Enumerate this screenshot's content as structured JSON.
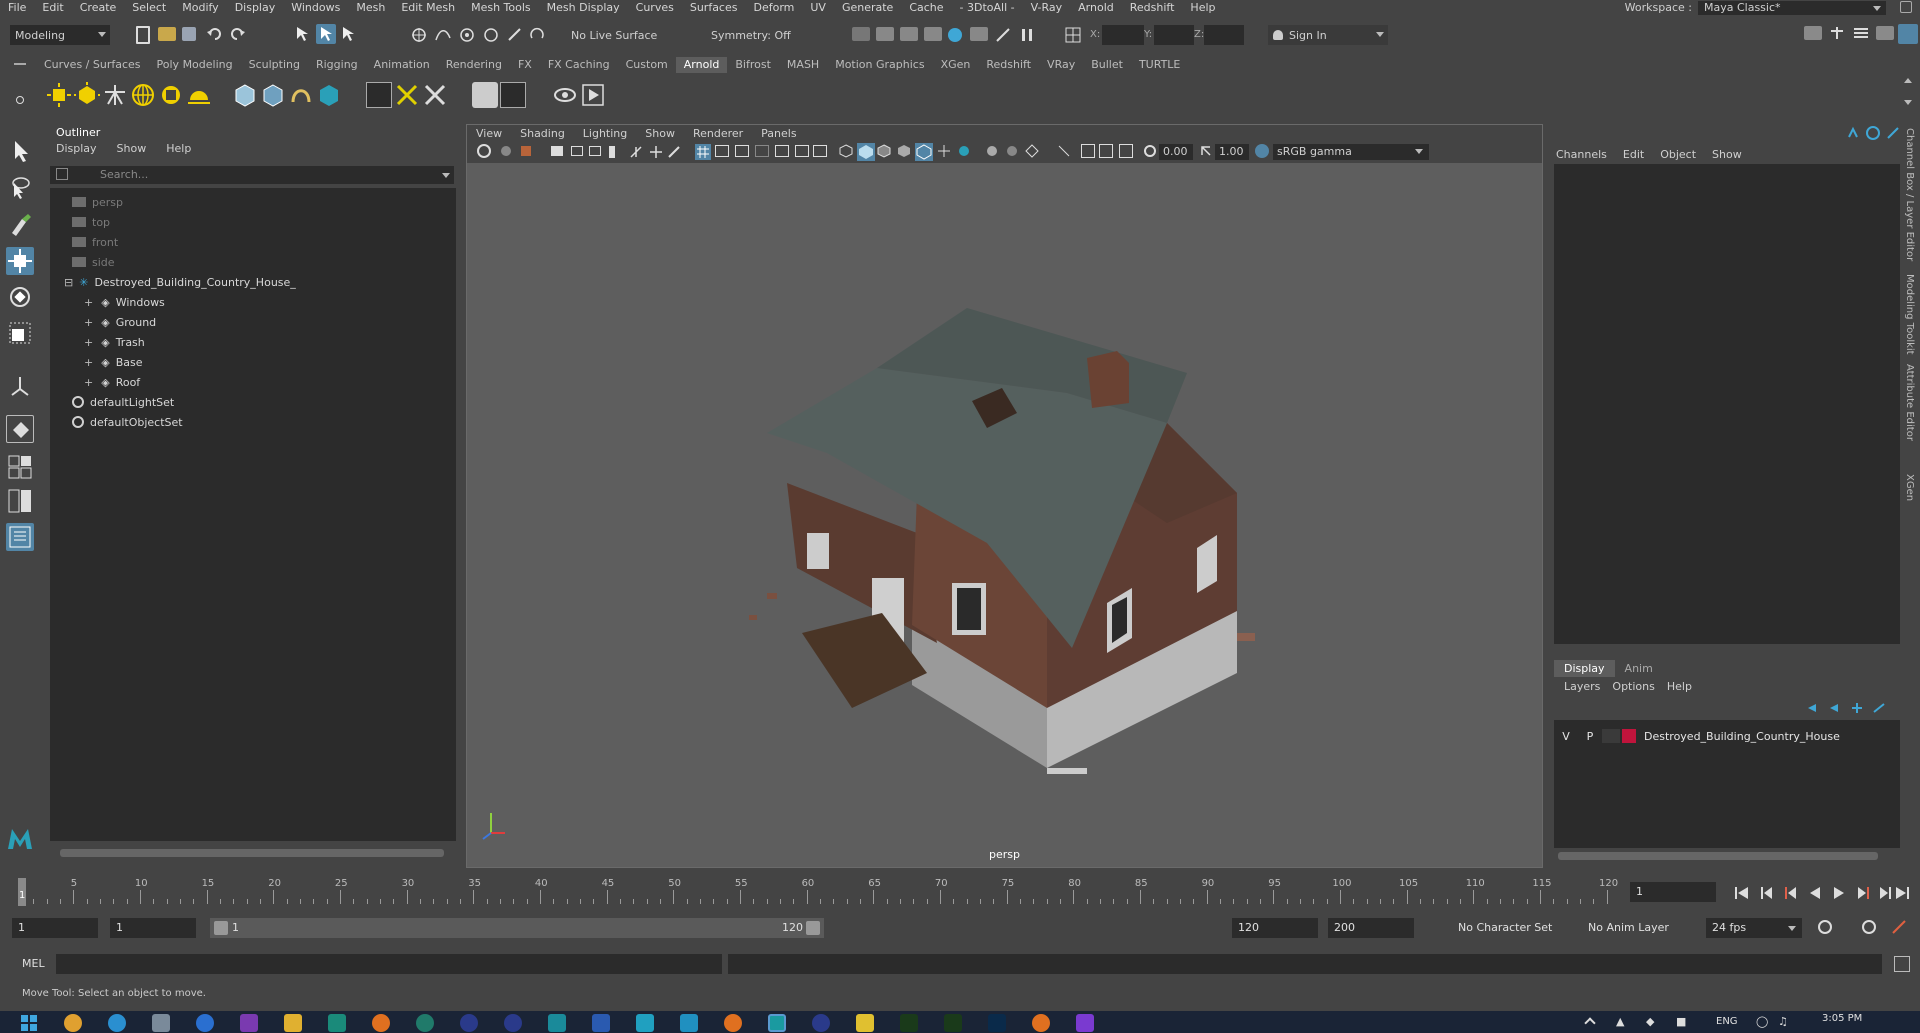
{
  "menubar": {
    "items": [
      "File",
      "Edit",
      "Create",
      "Select",
      "Modify",
      "Display",
      "Windows",
      "Mesh",
      "Edit Mesh",
      "Mesh Tools",
      "Mesh Display",
      "Curves",
      "Surfaces",
      "Deform",
      "UV",
      "Generate",
      "Cache",
      "- 3DtoAll -",
      "V-Ray",
      "Arnold",
      "Redshift",
      "Help"
    ],
    "workspace_label": "Workspace :",
    "workspace_value": "Maya Classic*"
  },
  "statusline": {
    "mode": "Modeling",
    "live_surface": "No Live Surface",
    "symmetry": "Symmetry: Off",
    "x_label": "X:",
    "y_label": "Y:",
    "z_label": "Z:",
    "sign_in": "Sign In"
  },
  "shelf": {
    "tabs": [
      "Curves / Surfaces",
      "Poly Modeling",
      "Sculpting",
      "Rigging",
      "Animation",
      "Rendering",
      "FX",
      "FX Caching",
      "Custom",
      "Arnold",
      "Bifrost",
      "MASH",
      "Motion Graphics",
      "XGen",
      "Redshift",
      "VRay",
      "Bullet",
      "TURTLE"
    ],
    "active_tab": "Arnold"
  },
  "outliner": {
    "title": "Outliner",
    "menu": [
      "Display",
      "Show",
      "Help"
    ],
    "search_placeholder": "Search...",
    "items": [
      {
        "label": "persp",
        "indent": 1,
        "dim": true,
        "icon": "camera-icon"
      },
      {
        "label": "top",
        "indent": 1,
        "dim": true,
        "icon": "camera-icon"
      },
      {
        "label": "front",
        "indent": 1,
        "dim": true,
        "icon": "camera-icon"
      },
      {
        "label": "side",
        "indent": 1,
        "dim": true,
        "icon": "camera-icon"
      },
      {
        "label": "Destroyed_Building_Country_House_",
        "indent": 0,
        "dim": false,
        "icon": "group-icon"
      },
      {
        "label": "Windows",
        "indent": 2,
        "dim": false,
        "icon": "mesh-icon"
      },
      {
        "label": "Ground",
        "indent": 2,
        "dim": false,
        "icon": "mesh-icon"
      },
      {
        "label": "Trash",
        "indent": 2,
        "dim": false,
        "icon": "mesh-icon"
      },
      {
        "label": "Base",
        "indent": 2,
        "dim": false,
        "icon": "mesh-icon"
      },
      {
        "label": "Roof",
        "indent": 2,
        "dim": false,
        "icon": "mesh-icon"
      },
      {
        "label": "defaultLightSet",
        "indent": 1,
        "dim": false,
        "icon": "set-icon"
      },
      {
        "label": "defaultObjectSet",
        "indent": 1,
        "dim": false,
        "icon": "set-icon"
      }
    ]
  },
  "viewport": {
    "menu": [
      "View",
      "Shading",
      "Lighting",
      "Show",
      "Renderer",
      "Panels"
    ],
    "exposure": "0.00",
    "gamma": "1.00",
    "color_space": "sRGB gamma",
    "camera_label": "persp"
  },
  "channelbox": {
    "menu": [
      "Channels",
      "Edit",
      "Object",
      "Show"
    ],
    "tabs": [
      "Display",
      "Anim"
    ],
    "active_tab": "Display",
    "layer_menu": [
      "Layers",
      "Options",
      "Help"
    ],
    "layer": {
      "v": "V",
      "p": "P",
      "name": "Destroyed_Building_Country_House",
      "color": "#c0143c"
    }
  },
  "sidetabs": [
    "Channel Box / Layer Editor",
    "Modeling Toolkit",
    "Attribute Editor",
    "XGen"
  ],
  "timeslider": {
    "ticks": [
      "5",
      "10",
      "15",
      "20",
      "25",
      "30",
      "35",
      "40",
      "45",
      "50",
      "55",
      "60",
      "65",
      "70",
      "75",
      "80",
      "85",
      "90",
      "95",
      "100",
      "105",
      "110",
      "115",
      "120"
    ],
    "current_frame_label": "1",
    "current_frame_field": "1"
  },
  "range": {
    "start": "1",
    "playback_start": "1",
    "range_start": "1",
    "range_end": "120",
    "playback_end": "120",
    "end": "200",
    "character_set": "No Character Set",
    "anim_layer": "No Anim Layer",
    "fps": "24 fps"
  },
  "commandline": {
    "language": "MEL"
  },
  "helpline": {
    "text": "Move Tool: Select an object to move."
  },
  "taskbar": {
    "language": "ENG",
    "time": "3:05 PM"
  }
}
